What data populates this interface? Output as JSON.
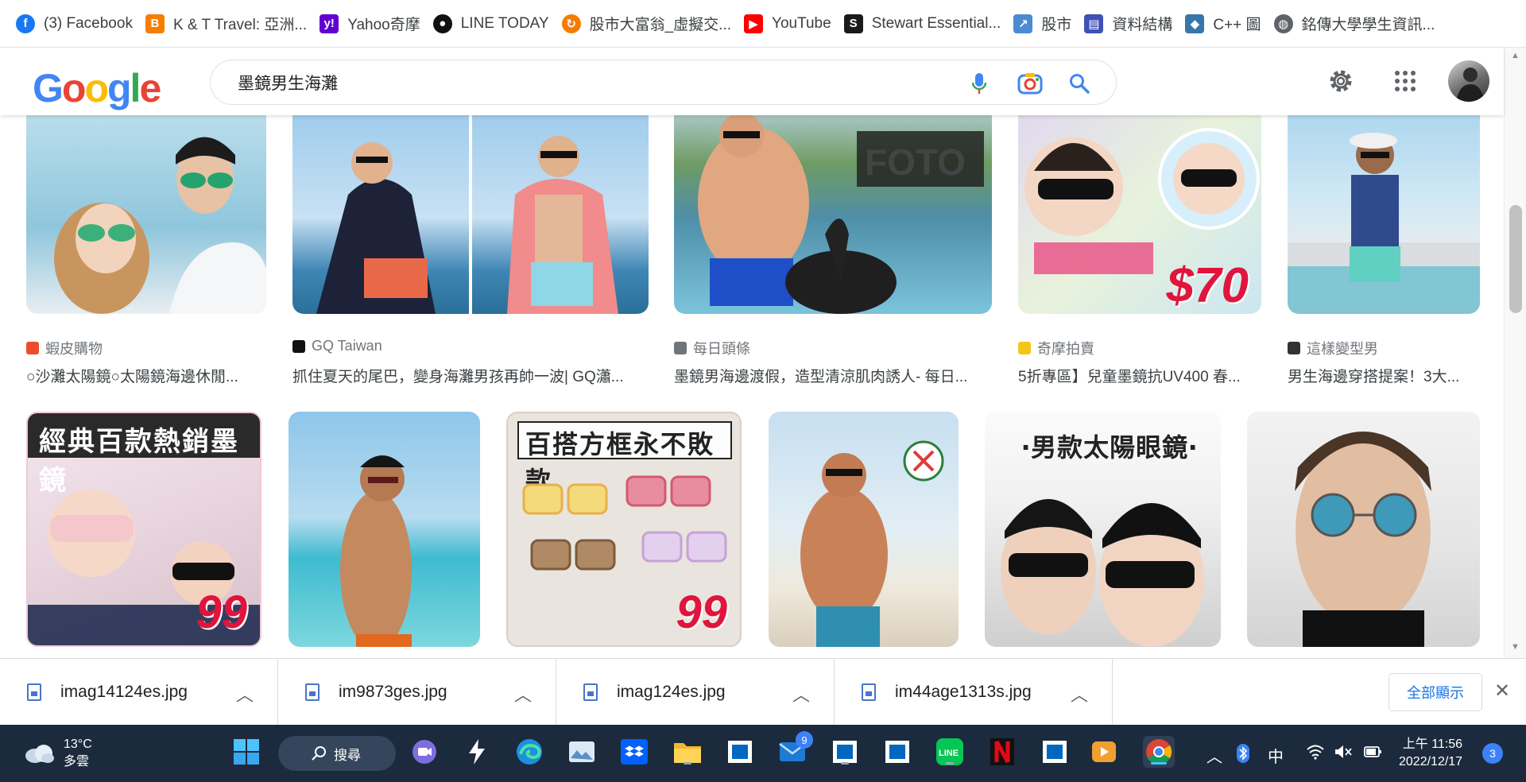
{
  "bookmarks": [
    {
      "label": "(3) Facebook",
      "icon": "facebook-icon",
      "color": "#1877f2"
    },
    {
      "label": "K & T Travel: 亞洲...",
      "icon": "blogger-icon",
      "color": "#f57d00"
    },
    {
      "label": "Yahoo奇摩",
      "icon": "yahoo-icon",
      "color": "#6001d2"
    },
    {
      "label": "LINE TODAY",
      "icon": "line-today-icon",
      "color": "#111111"
    },
    {
      "label": "股市大富翁_虛擬交...",
      "icon": "refresh-logo-icon",
      "color": "#f57c00"
    },
    {
      "label": "YouTube",
      "icon": "youtube-icon",
      "color": "#ff0000"
    },
    {
      "label": "Stewart Essential...",
      "icon": "stewart-icon",
      "color": "#1a1a1a"
    },
    {
      "label": "股市",
      "icon": "chart-icon",
      "color": "#4a8bd4"
    },
    {
      "label": "資料結構",
      "icon": "form-icon",
      "color": "#3f51b5"
    },
    {
      "label": "C++ 圖",
      "icon": "python-icon",
      "color": "#3776ab"
    },
    {
      "label": "銘傳大學學生資訊...",
      "icon": "globe-icon",
      "color": "#5f6368"
    }
  ],
  "search": {
    "query": "墨鏡男生海灘",
    "logo_letters": [
      "G",
      "o",
      "o",
      "g",
      "l",
      "e"
    ]
  },
  "results_row1": [
    {
      "source": "蝦皮購物",
      "source_icon": "shopee-icon",
      "source_color": "#ee4d2d",
      "title": "○沙灘太陽鏡○太陽鏡海邊休閒..."
    },
    {
      "source": "GQ Taiwan",
      "source_icon": "gq-icon",
      "source_color": "#111111",
      "title": "抓住夏天的尾巴，變身海灘男孩再帥一波| GQ瀟..."
    },
    {
      "source": "每日頭條",
      "source_icon": "globe-icon",
      "source_color": "#70757a",
      "title": "墨鏡男海邊渡假，造型清涼肌肉誘人- 每日..."
    },
    {
      "source": "奇摩拍賣",
      "source_icon": "yahoo-auction-icon",
      "source_color": "#f5c518",
      "title": "5折專區】兒童墨鏡抗UV400 春..."
    },
    {
      "source": "這樣變型男",
      "source_icon": "m-logo-icon",
      "source_color": "#333333",
      "title": "男生海邊穿搭提案！3大..."
    }
  ],
  "results_row2": [
    {
      "caption": "經典百款熱銷墨鏡",
      "price": "99"
    },
    {
      "caption": "",
      "price": ""
    },
    {
      "caption": "百搭方框永不敗款",
      "price": "99"
    },
    {
      "caption": "",
      "price": ""
    },
    {
      "caption": "‧男款太陽眼鏡‧",
      "price": ""
    },
    {
      "caption": "",
      "price": ""
    }
  ],
  "kids_price": "$70",
  "downloads": [
    {
      "filename": "imag14124es.jpg"
    },
    {
      "filename": "im9873ges.jpg"
    },
    {
      "filename": "imag124es.jpg"
    },
    {
      "filename": "im44age1313s.jpg"
    }
  ],
  "download_bar": {
    "show_all": "全部顯示"
  },
  "taskbar": {
    "weather_temp": "13°C",
    "weather_desc": "多雲",
    "search_label": "搜尋",
    "mail_badge": "9",
    "ime": "中",
    "time": "上午 11:56",
    "date": "2022/12/17",
    "notifications": "3"
  }
}
